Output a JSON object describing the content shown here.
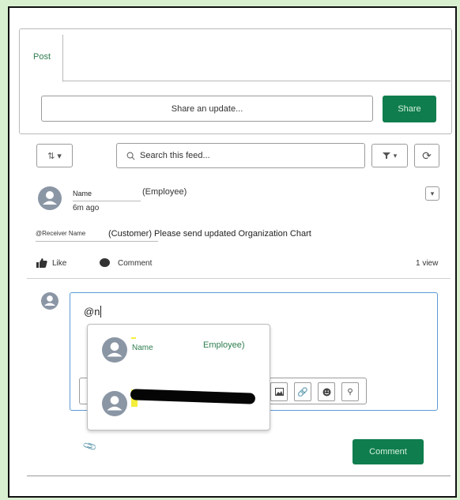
{
  "publisher": {
    "post_tab": "Post",
    "share_placeholder": "Share an update...",
    "share_button": "Share"
  },
  "toolbar": {
    "sort_label": "⇅ ▾",
    "search_placeholder": "Search this feed...",
    "filter_label": "▾",
    "refresh_label": "⟳"
  },
  "feed_item": {
    "author_name": "Name",
    "author_role": "(Employee)",
    "timestamp": "6m ago",
    "mention": "@Receiver Name",
    "mention_suffix": "(Customer) Please send updated Organization Chart",
    "like_label": "Like",
    "comment_label": "Comment",
    "views": "1 view"
  },
  "comment_box": {
    "typed_text": "@n"
  },
  "mention_dropdown": {
    "items": [
      {
        "name": "Name",
        "role": "Employee)"
      },
      {
        "name": "",
        "role": ""
      }
    ]
  },
  "comment_button": "Comment",
  "colors": {
    "brand_green": "#0f7d4d",
    "focus_blue": "#5b9bd5",
    "highlight_yellow": "#f3ee3a"
  }
}
